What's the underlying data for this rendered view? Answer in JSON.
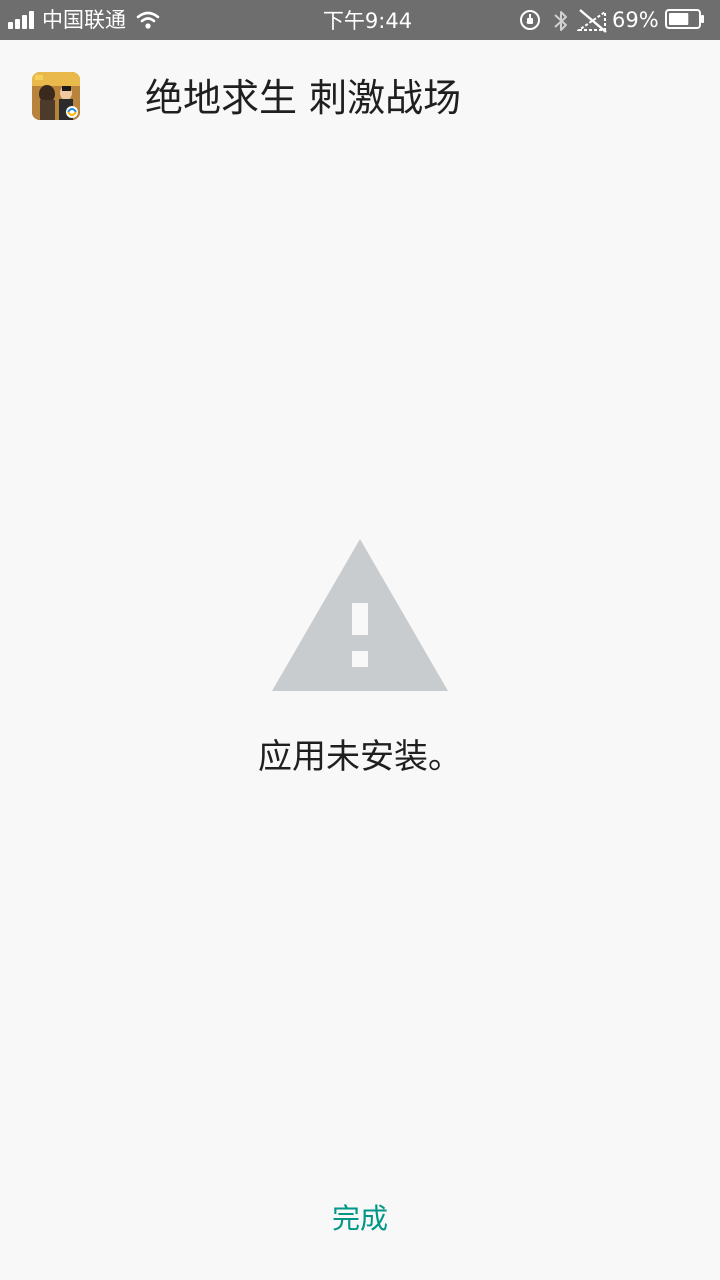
{
  "status_bar": {
    "carrier": "中国联通",
    "time": "下午9:44",
    "battery_percent": "69%",
    "battery_level": 0.69
  },
  "header": {
    "app_title": "绝地求生 刺激战场"
  },
  "main": {
    "message": "应用未安装。"
  },
  "footer": {
    "done_label": "完成"
  },
  "colors": {
    "background": "#f8f8f8",
    "status_bar": "#6e6e6e",
    "accent": "#009688",
    "warning_icon": "#c9ccce",
    "text": "#1f1f1f"
  },
  "icons": {
    "signal": "signal-icon",
    "wifi": "wifi-icon",
    "alarm": "alarm-icon",
    "bluetooth": "bluetooth-icon",
    "no_sim": "no-sim-icon",
    "battery": "battery-icon",
    "warning": "warning-icon"
  }
}
